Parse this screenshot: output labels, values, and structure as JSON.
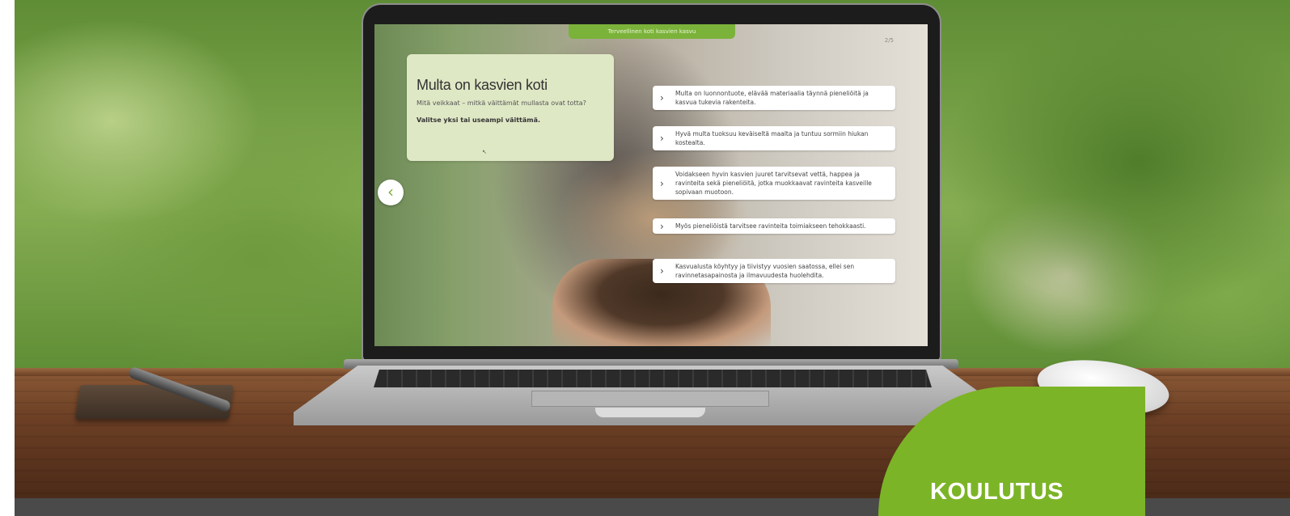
{
  "screen": {
    "topbar_label": "Terveellinen koti kasvien kasvu",
    "counter": "2/5",
    "question": {
      "title": "Multa on kasvien koti",
      "text": "Mitä veikkaat – mitkä väittämät mullasta ovat totta?",
      "instruction": "Valitse yksi tai useampi väittämä."
    },
    "back_icon": "chevron-left-icon",
    "options": [
      "Multa on luonnontuote, elävää materiaalia täynnä pieneliöitä ja kasvua tukevia rakenteita.",
      "Hyvä multa tuoksuu keväiseltä maalta ja tuntuu sormiin hiukan kostealta.",
      "Voidakseen hyvin kasvien juuret tarvitsevat vettä, happea ja ravinteita sekä pieneliöitä, jotka muokkaavat ravinteita kasveille sopivaan muotoon.",
      "Myös pieneliöistä tarvitsee ravinteita toimiakseen tehokkaasti.",
      "Kasvualusta köyhtyy ja tiivistyy vuosien saatossa, ellei sen ravinnetasapainosta ja ilmavuudesta huolehdita."
    ]
  },
  "badge": {
    "label": "KOULUTUS",
    "color": "#7cb427"
  }
}
